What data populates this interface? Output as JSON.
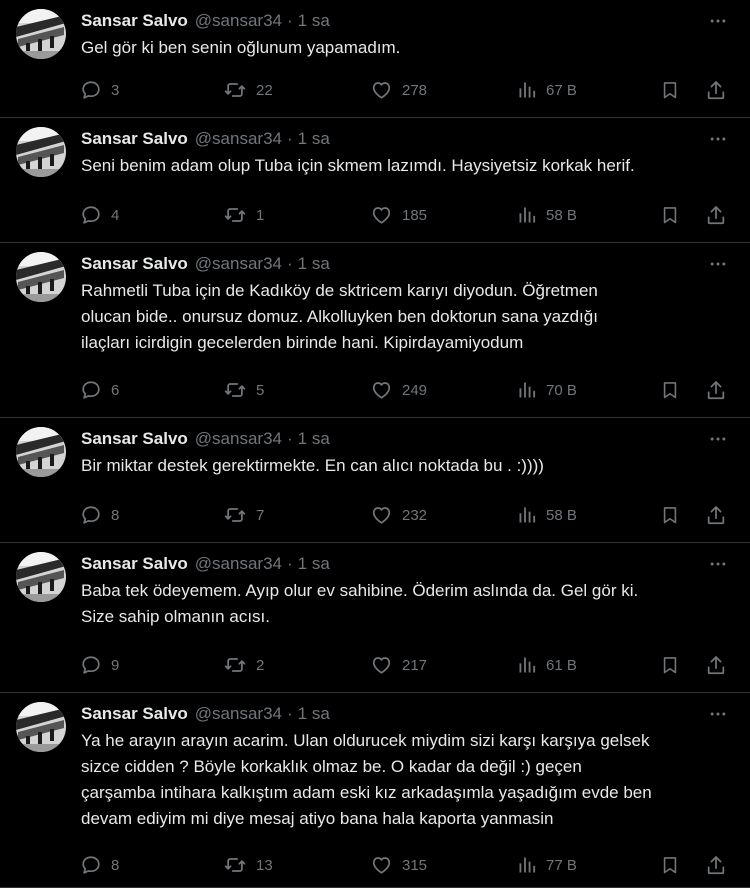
{
  "colors": {
    "background": "#000000",
    "text_primary": "#e7e9ea",
    "text_secondary": "#71767b",
    "divider": "#2f3336"
  },
  "icons": {
    "more": "more-dots-icon",
    "reply": "reply-icon",
    "retweet": "retweet-icon",
    "like": "like-icon",
    "views": "views-icon",
    "bookmark": "bookmark-icon",
    "share": "share-icon"
  },
  "tweets": [
    {
      "name": "Sansar Salvo",
      "handle": "@sansar34",
      "separator": "·",
      "time": "1 sa",
      "lines": [
        "Gel gör ki ben senin oğlunum yapamadım."
      ],
      "replies": "3",
      "retweets": "22",
      "likes": "278",
      "views": "67 B"
    },
    {
      "name": "Sansar Salvo",
      "handle": "@sansar34",
      "separator": "·",
      "time": "1 sa",
      "lines": [
        "Seni benim adam olup Tuba için skmem lazımdı. Haysiyetsiz korkak herif."
      ],
      "replies": "4",
      "retweets": "1",
      "likes": "185",
      "views": "58 B"
    },
    {
      "name": "Sansar Salvo",
      "handle": "@sansar34",
      "separator": "·",
      "time": "1 sa",
      "lines": [
        "Rahmetli Tuba için de Kadıköy de sktricem karıyı diyodun. Öğretmen",
        "olucan bide.. onursuz domuz. Alkolluyken ben doktorun sana yazdığı",
        "ilaçları icirdigin gecelerden birinde hani. Kipirdayamiyodum"
      ],
      "replies": "6",
      "retweets": "5",
      "likes": "249",
      "views": "70 B"
    },
    {
      "name": "Sansar Salvo",
      "handle": "@sansar34",
      "separator": "·",
      "time": "1 sa",
      "lines": [
        "Bir miktar destek gerektirmekte.  En can alıcı noktada bu . :))))"
      ],
      "replies": "8",
      "retweets": "7",
      "likes": "232",
      "views": "58 B"
    },
    {
      "name": "Sansar Salvo",
      "handle": "@sansar34",
      "separator": "·",
      "time": "1 sa",
      "lines": [
        "Baba tek ödeyemem. Ayıp olur ev sahibine. Öderim aslında da.  Gel gör ki.",
        "Size sahip olmanın acısı."
      ],
      "replies": "9",
      "retweets": "2",
      "likes": "217",
      "views": "61 B"
    },
    {
      "name": "Sansar Salvo",
      "handle": "@sansar34",
      "separator": "·",
      "time": "1 sa",
      "lines": [
        "Ya he arayın arayın acarim. Ulan oldurucek miydim sizi karşı karşıya gelsek",
        "sizce cidden ? Böyle korkaklık olmaz be. O kadar da değil :) geçen",
        "çarşamba intihara kalkıştım adam eski kız arkadaşımla yaşadığım evde ben",
        "devam ediyim mi diye mesaj atiyo bana hala kaporta yanmasin"
      ],
      "replies": "8",
      "retweets": "13",
      "likes": "315",
      "views": "77 B"
    }
  ]
}
